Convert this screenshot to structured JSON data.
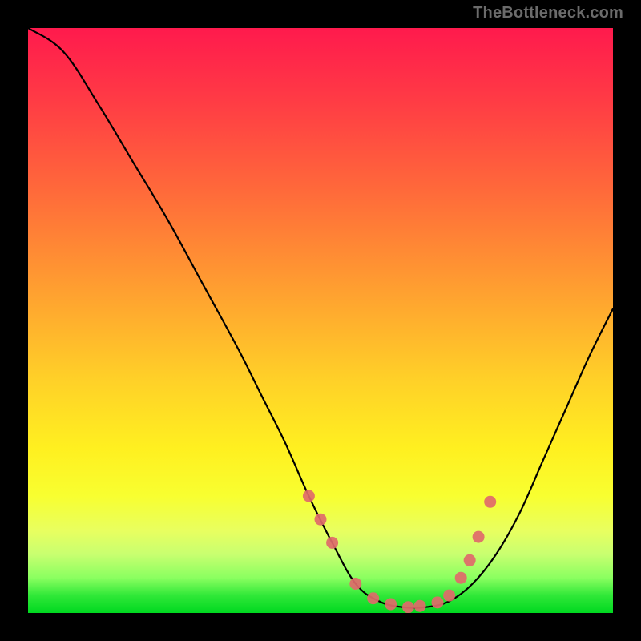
{
  "watermark": "TheBottleneck.com",
  "chart_data": {
    "type": "line",
    "title": "",
    "xlabel": "",
    "ylabel": "",
    "xlim": [
      0,
      100
    ],
    "ylim": [
      0,
      100
    ],
    "series": [
      {
        "name": "bottleneck-curve",
        "x": [
          0,
          6,
          12,
          18,
          24,
          30,
          36,
          40,
          44,
          48,
          52,
          56,
          60,
          64,
          68,
          72,
          76,
          80,
          84,
          88,
          92,
          96,
          100
        ],
        "values": [
          100,
          96,
          87,
          77,
          67,
          56,
          45,
          37,
          29,
          20,
          12,
          5,
          2,
          1,
          1,
          2,
          5,
          10,
          17,
          26,
          35,
          44,
          52
        ]
      }
    ],
    "markers": {
      "name": "highlight-points",
      "color": "#e06a6a",
      "x": [
        48,
        50,
        52,
        56,
        59,
        62,
        65,
        67,
        70,
        72,
        74,
        75.5,
        77,
        79
      ],
      "values": [
        20,
        16,
        12,
        5,
        2.5,
        1.5,
        1,
        1.2,
        1.8,
        3,
        6,
        9,
        13,
        19
      ]
    }
  }
}
